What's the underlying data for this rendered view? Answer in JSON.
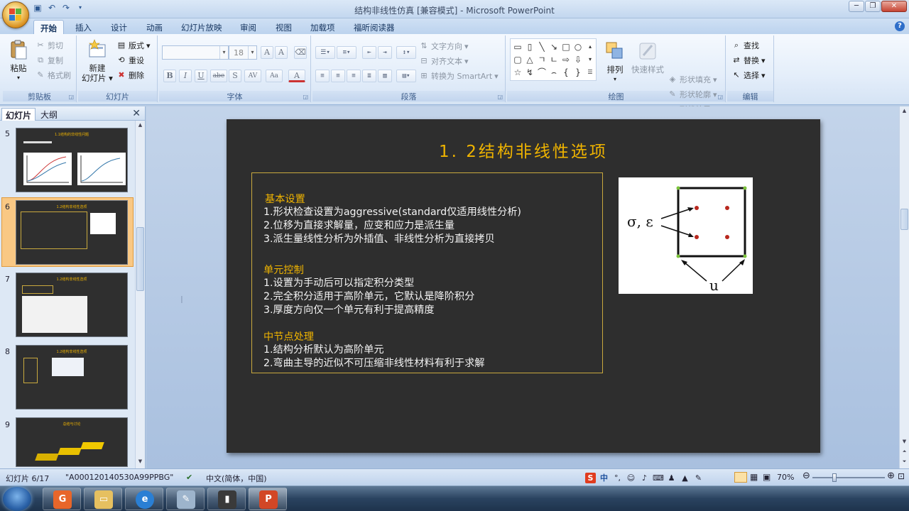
{
  "window": {
    "title": "结构非线性仿真 [兼容模式] - Microsoft PowerPoint",
    "minimize_icon": "minimize-icon",
    "restore_icon": "restore-icon",
    "close_icon": "close-icon"
  },
  "ribbon_tabs": [
    "开始",
    "插入",
    "设计",
    "动画",
    "幻灯片放映",
    "审阅",
    "视图",
    "加载项",
    "福昕阅读器"
  ],
  "ribbon": {
    "clipboard": {
      "label": "剪贴板",
      "paste": "粘贴",
      "cut": "剪切",
      "copy": "复制",
      "format_painter": "格式刷"
    },
    "slides": {
      "label": "幻灯片",
      "new_slide_1": "新建",
      "new_slide_2": "幻灯片",
      "layout": "版式",
      "reset": "重设",
      "delete": "删除"
    },
    "font": {
      "label": "字体",
      "font_name": "",
      "font_size": "18",
      "bold": "B",
      "italic": "I",
      "underline": "U",
      "strike": "abe",
      "shadow": "S",
      "spacing": "AV",
      "case": "Aa",
      "color": "A"
    },
    "paragraph": {
      "label": "段落",
      "text_direction": "文字方向",
      "align_text": "对齐文本",
      "smartart": "转换为 SmartArt"
    },
    "drawing": {
      "label": "绘图",
      "arrange": "排列",
      "quick_styles": "快速样式",
      "shape_fill": "形状填充",
      "shape_outline": "形状轮廓",
      "shape_effects": "形状效果"
    },
    "editing": {
      "label": "编辑",
      "find": "查找",
      "replace": "替换",
      "select": "选择"
    }
  },
  "left_pane": {
    "tab_slides": "幻灯片",
    "tab_outline": "大纲",
    "thumbnails": [
      {
        "num": "5",
        "title": "1.1结构的非线性问题"
      },
      {
        "num": "6",
        "title": "1.2结构非线性选项"
      },
      {
        "num": "7",
        "title": "1.2结构非线性选项"
      },
      {
        "num": "8",
        "title": "1.2结构非线性选项"
      },
      {
        "num": "9",
        "title": "总结与讨论"
      }
    ]
  },
  "slide": {
    "title": "1. 2结构非线性选项",
    "lines": [
      {
        "text": "基本设置",
        "heading": true
      },
      {
        "text": "1.形状检查设置为aggressive(standard仅适用线性分析)",
        "heading": false
      },
      {
        "text": "2.位移为直接求解量，应变和应力是派生量",
        "heading": false
      },
      {
        "text": "3.派生量线性分析为外插值、非线性分析为直接拷贝",
        "heading": false
      },
      {
        "text": "单元控制",
        "heading": true
      },
      {
        "text": "1.设置为手动后可以指定积分类型",
        "heading": false
      },
      {
        "text": "2.完全积分适用于高阶单元，它默认是降阶积分",
        "heading": false
      },
      {
        "text": "3.厚度方向仅一个单元有利于提高精度",
        "heading": false
      },
      {
        "text": "中节点处理",
        "heading": true
      },
      {
        "text": "1.结构分析默认为高阶单元",
        "heading": false
      },
      {
        "text": "2.弯曲主导的近似不可压缩非线性材料有利于求解",
        "heading": false
      }
    ],
    "figure": {
      "stress_label": "σ, ε",
      "disp_label": "u"
    }
  },
  "statusbar": {
    "slide_info": "幻灯片 6/17",
    "theme": "\"A000120140530A99PPBG\"",
    "language": "中文(简体，中国)",
    "zoom": "70%",
    "ime_cn": "中"
  },
  "taskbar": {
    "items": [
      "foxit-pdf",
      "file-explorer",
      "internet-explorer",
      "paint",
      "media",
      "powerpoint"
    ]
  }
}
